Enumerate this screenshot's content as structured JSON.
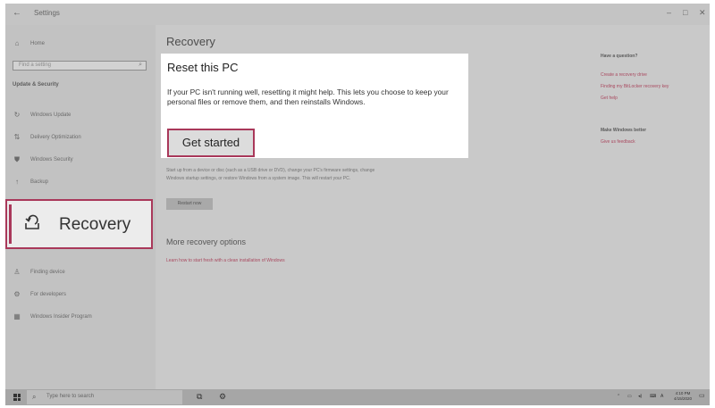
{
  "window": {
    "title": "Settings",
    "back_glyph": "←",
    "minimize_glyph": "–",
    "maximize_glyph": "□",
    "close_glyph": "✕"
  },
  "sidebar": {
    "home_label": "Home",
    "search_placeholder": "Find a setting",
    "section_label": "Update & Security",
    "items": [
      {
        "label": "Windows Update",
        "icon": "refresh-icon",
        "glyph": "↻"
      },
      {
        "label": "Delivery Optimization",
        "icon": "delivery-icon",
        "glyph": "⇅"
      },
      {
        "label": "Windows Security",
        "icon": "shield-icon",
        "glyph": "⛊"
      },
      {
        "label": "Backup",
        "icon": "backup-icon",
        "glyph": "↑"
      },
      {
        "label": "Recovery",
        "icon": "recovery-icon",
        "glyph": ""
      },
      {
        "label": "Finding device",
        "icon": "person-icon",
        "glyph": "♙"
      },
      {
        "label": "For developers",
        "icon": "developer-icon",
        "glyph": "⚙"
      },
      {
        "label": "Windows Insider Program",
        "icon": "insider-icon",
        "glyph": "▦"
      }
    ]
  },
  "main": {
    "page_title": "Recovery",
    "reset": {
      "heading": "Reset this PC",
      "description": "If your PC isn't running well, resetting it might help. This lets you choose to keep your personal files or remove them, and then reinstalls Windows.",
      "button_label": "Get started"
    },
    "advanced": {
      "description": "Start up from a device or disc (such as a USB drive or DVD), change your PC's firmware settings, change Windows startup settings, or restore Windows from a system image. This will restart your PC.",
      "button_label": "Restart now"
    },
    "more": {
      "title": "More recovery options",
      "link": "Learn how to start fresh with a clean installation of Windows"
    }
  },
  "right_column": {
    "question_heading": "Have a question?",
    "links": [
      "Create a recovery drive",
      "Finding my BitLocker recovery key",
      "Get help"
    ],
    "better_heading": "Make Windows better",
    "feedback_link": "Give us feedback"
  },
  "taskbar": {
    "search_placeholder": "Type here to search",
    "time": "4:10 PM",
    "date": "4/15/2020"
  },
  "colors": {
    "highlight": "#a9385a",
    "link": "#a94a60"
  }
}
